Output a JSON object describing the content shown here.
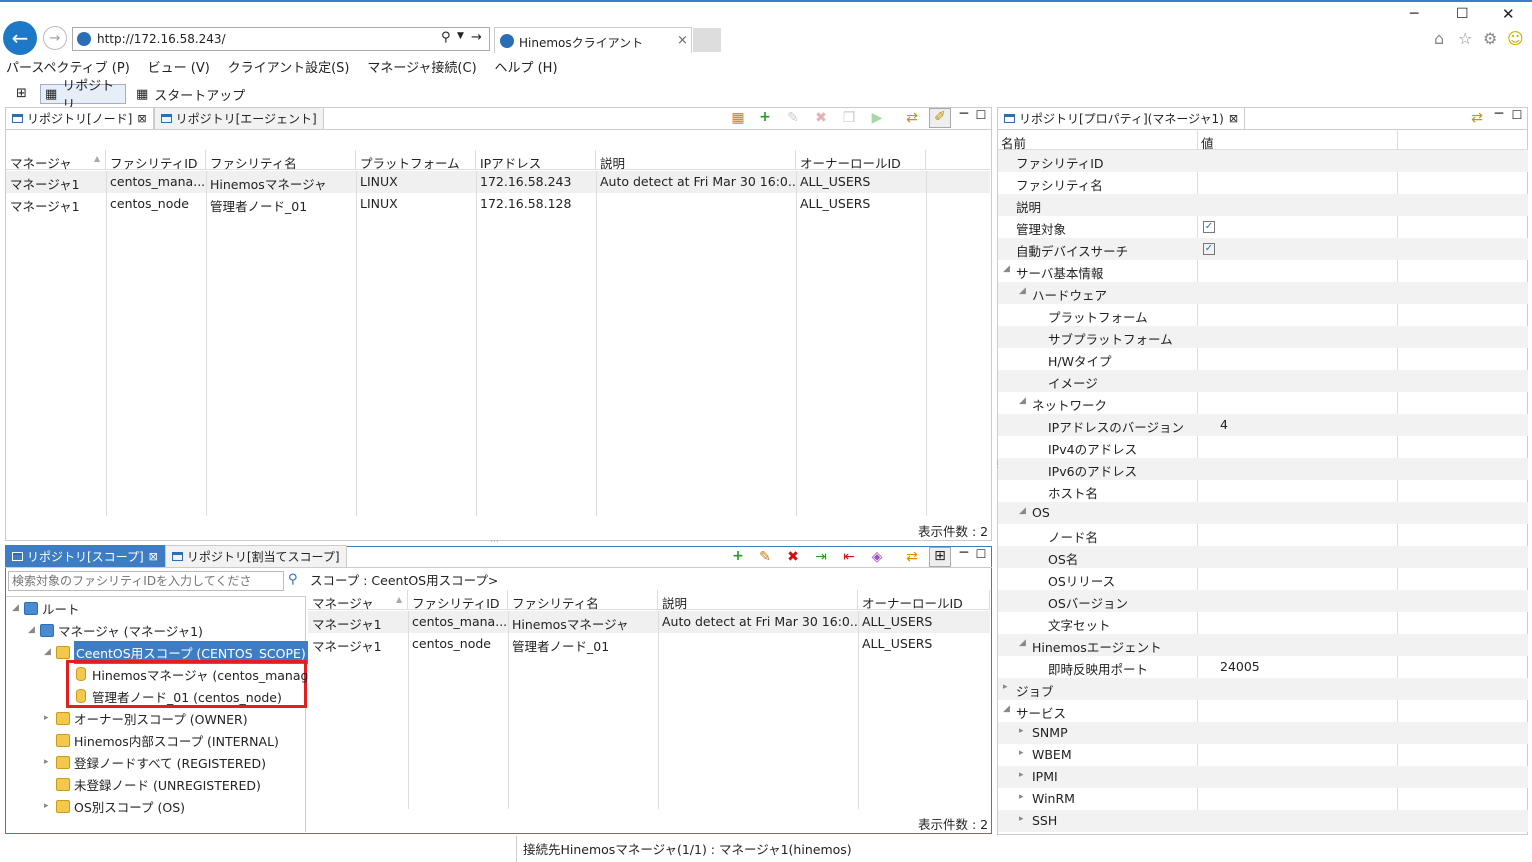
{
  "browser": {
    "url": "http://172.16.58.243/",
    "tab_title": "Hinemosクライアント"
  },
  "menu": [
    "パースペクティブ (P)",
    "ビュー (V)",
    "クライアント設定(S)",
    "マネージャ接続(C)",
    "ヘルプ (H)"
  ],
  "perspectives": [
    "リポジトリ",
    "スタートアップ"
  ],
  "node_view": {
    "tabs": [
      "リポジトリ[ノード]",
      "リポジトリ[エージェント]"
    ],
    "columns": [
      "マネージャ",
      "ファシリティID",
      "ファシリティ名",
      "プラットフォーム",
      "IPアドレス",
      "説明",
      "オーナーロールID"
    ],
    "rows": [
      [
        "マネージャ1",
        "centos_mana...",
        "Hinemosマネージャ",
        "LINUX",
        "172.16.58.243",
        "Auto detect at Fri Mar 30 16:0...",
        "ALL_USERS"
      ],
      [
        "マネージャ1",
        "centos_node",
        "管理者ノード_01",
        "LINUX",
        "172.16.58.128",
        "",
        "ALL_USERS"
      ]
    ],
    "count": "表示件数 : 2"
  },
  "scope_view": {
    "tabs": [
      "リポジトリ[スコープ]",
      "リポジトリ[割当てスコープ]"
    ],
    "search_placeholder": "検索対象のファシリティIDを入力してくださ",
    "scope_path": "スコープ : CeentOS用スコープ>",
    "tree": [
      "ルート",
      "マネージャ (マネージャ1)",
      "CeentOS用スコープ (CENTOS_SCOPE)",
      "Hinemosマネージャ (centos_manag",
      "管理者ノード_01 (centos_node)",
      "オーナー別スコープ (OWNER)",
      "Hinemos内部スコープ (INTERNAL)",
      "登録ノードすべて (REGISTERED)",
      "未登録ノード (UNREGISTERED)",
      "OS別スコープ (OS)"
    ],
    "columns": [
      "マネージャ",
      "ファシリティID",
      "ファシリティ名",
      "説明",
      "オーナーロールID"
    ],
    "rows": [
      [
        "マネージャ1",
        "centos_mana...",
        "Hinemosマネージャ",
        "Auto detect at Fri Mar 30 16:0...",
        "ALL_USERS"
      ],
      [
        "マネージャ1",
        "centos_node",
        "管理者ノード_01",
        "",
        "ALL_USERS"
      ]
    ],
    "count": "表示件数 : 2"
  },
  "property_view": {
    "tab": "リポジトリ[プロパティ](マネージャ1)",
    "col_name": "名前",
    "col_value": "値",
    "rows": [
      {
        "name": "ファシリティID",
        "value": ""
      },
      {
        "name": "ファシリティ名",
        "value": ""
      },
      {
        "name": "説明",
        "value": ""
      },
      {
        "name": "管理対象",
        "value": "",
        "check": true
      },
      {
        "name": "自動デバイスサーチ",
        "value": "",
        "check": true
      },
      {
        "name": "サーバ基本情報",
        "value": ""
      },
      {
        "name": "ハードウェア",
        "value": ""
      },
      {
        "name": "プラットフォーム",
        "value": ""
      },
      {
        "name": "サブプラットフォーム",
        "value": ""
      },
      {
        "name": "H/Wタイプ",
        "value": ""
      },
      {
        "name": "イメージ",
        "value": ""
      },
      {
        "name": "ネットワーク",
        "value": ""
      },
      {
        "name": "IPアドレスのバージョン",
        "value": "4"
      },
      {
        "name": "IPv4のアドレス",
        "value": ""
      },
      {
        "name": "IPv6のアドレス",
        "value": ""
      },
      {
        "name": "ホスト名",
        "value": ""
      },
      {
        "name": "OS",
        "value": ""
      },
      {
        "name": "ノード名",
        "value": ""
      },
      {
        "name": "OS名",
        "value": ""
      },
      {
        "name": "OSリリース",
        "value": ""
      },
      {
        "name": "OSバージョン",
        "value": ""
      },
      {
        "name": "文字セット",
        "value": ""
      },
      {
        "name": "Hinemosエージェント",
        "value": ""
      },
      {
        "name": "即時反映用ポート",
        "value": "24005"
      },
      {
        "name": "ジョブ",
        "value": ""
      },
      {
        "name": "サービス",
        "value": ""
      },
      {
        "name": "SNMP",
        "value": ""
      },
      {
        "name": "WBEM",
        "value": ""
      },
      {
        "name": "IPMI",
        "value": ""
      },
      {
        "name": "WinRM",
        "value": ""
      },
      {
        "name": "SSH",
        "value": ""
      }
    ]
  },
  "status": "接続先Hinemosマネージャ(1/1) : マネージャ1(hinemos)"
}
